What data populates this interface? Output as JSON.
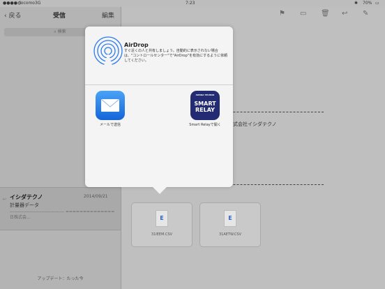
{
  "status": {
    "carrier": "docomo",
    "network": "3G",
    "time": "7:23",
    "battery": "70%"
  },
  "sidebar": {
    "back_label": "戻る",
    "title": "受信",
    "edit_label": "編集",
    "search_placeholder": "検索",
    "message": {
      "sender": "イシダテクノ",
      "date": "2014/09/21",
      "subject": "計量器データ",
      "preview": "------------------------------------ ============== 日株式会..."
    },
    "footer": "アップデート：たった今"
  },
  "detail": {
    "company_text": "式会社イシダテクノ",
    "attachments": [
      {
        "name": "31IEEM.CSV",
        "icon": "E"
      },
      {
        "name": "31AETW.CSV",
        "icon": "E"
      }
    ]
  },
  "share_sheet": {
    "airdrop_title": "AirDrop",
    "airdrop_description": "すぐ近くの人と共有しましょう。自動的に表示されない場合は、\"コントロールセンター\"で\"AirDrop\"を有効にするように依頼してください。",
    "apps": [
      {
        "label": "メールで送信",
        "icon": "mail-icon"
      },
      {
        "label": "Smart Relayで開く",
        "icon": "smart-relay-icon",
        "icon_top": "ISHIDA TECHNO",
        "icon_line1": "SMART",
        "icon_line2": "RELAY"
      }
    ]
  }
}
